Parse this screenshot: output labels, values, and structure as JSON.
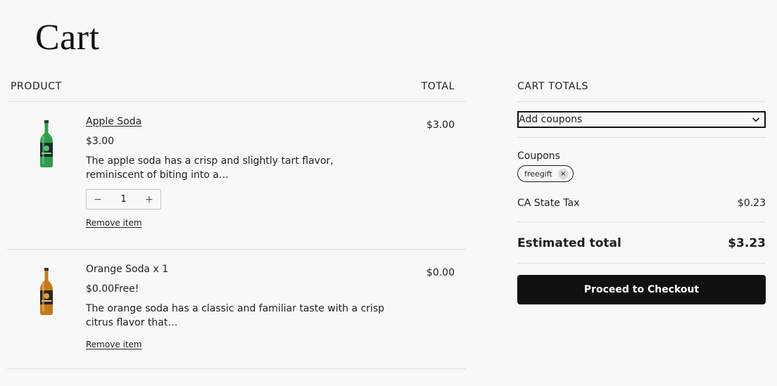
{
  "page": {
    "title": "Cart"
  },
  "table": {
    "product_header": "PRODUCT",
    "total_header": "TOTAL"
  },
  "items": [
    {
      "name": "Apple Soda",
      "price": "$3.00",
      "description": "The apple soda has a crisp and slightly tart flavor, reminiscent of biting into a…",
      "quantity": "1",
      "decrease_symbol": "−",
      "increase_symbol": "+",
      "remove_label": "Remove item",
      "total": "$3.00",
      "bottle_color": "#2e9d4c"
    },
    {
      "name": "Orange Soda x 1",
      "price": "$0.00Free!",
      "description": "The orange soda has a classic and familiar taste with a crisp citrus flavor that…",
      "remove_label": "Remove item",
      "total": "$0.00",
      "bottle_color": "#c27a1c"
    }
  ],
  "totals": {
    "header": "CART TOTALS",
    "add_coupons_label": "Add coupons",
    "coupons_label": "Coupons",
    "coupon_code": "freegift",
    "coupon_remove_symbol": "×",
    "tax_label": "CA State Tax",
    "tax_value": "$0.23",
    "estimated_label": "Estimated total",
    "estimated_value": "$3.23",
    "checkout_label": "Proceed to Checkout"
  },
  "icons": {
    "dropdown": "chevron-down-icon",
    "product_image": "soda-bottle-icon"
  }
}
